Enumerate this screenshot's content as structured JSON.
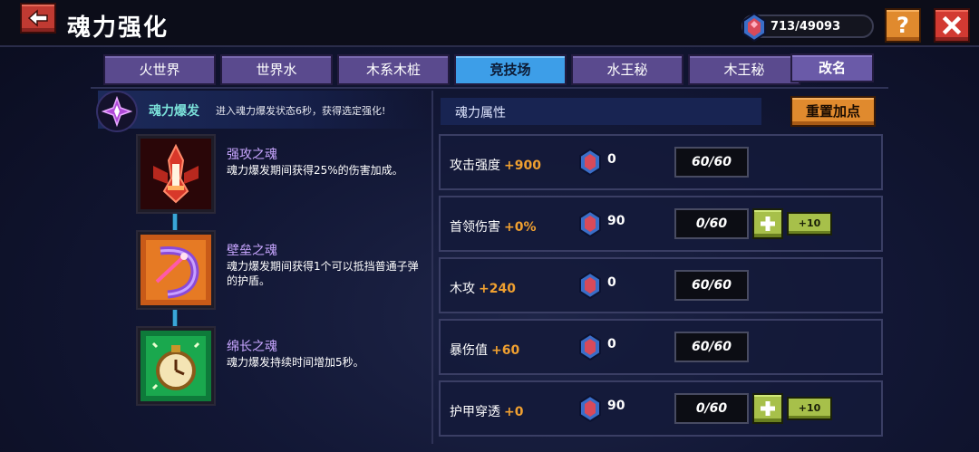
{
  "header": {
    "title": "魂力强化",
    "currency": "713/49093"
  },
  "buttons": {
    "help": "?",
    "rename": "改名",
    "reset": "重置加点"
  },
  "tabs": [
    {
      "label": "火世界",
      "active": false
    },
    {
      "label": "世界水",
      "active": false
    },
    {
      "label": "木系木桩",
      "active": false
    },
    {
      "label": "竞技场",
      "active": true
    },
    {
      "label": "水王秘",
      "active": false
    },
    {
      "label": "木王秘",
      "active": false
    }
  ],
  "burst": {
    "name": "魂力爆发",
    "desc": "进入魂力爆发状态6秒，获得选定强化!"
  },
  "souls": [
    {
      "name": "强攻之魂",
      "desc": "魂力爆发期间获得25%的伤害加成。",
      "icon": "red-sword-soul-icon"
    },
    {
      "name": "壁垒之魂",
      "desc": "魂力爆发期间获得1个可以抵挡普通子弹的护盾。",
      "icon": "orange-shield-soul-icon"
    },
    {
      "name": "绵长之魂",
      "desc": "魂力爆发持续时间增加5秒。",
      "icon": "green-clock-soul-icon"
    }
  ],
  "attr_header": "魂力属性",
  "attributes": [
    {
      "label": "攻击强度",
      "bonus": "+900",
      "cost": "0",
      "level": "60/60",
      "can_upgrade": false
    },
    {
      "label": "首领伤害",
      "bonus": "+0%",
      "cost": "90",
      "level": "0/60",
      "can_upgrade": true,
      "plus10": "+10"
    },
    {
      "label": "木攻",
      "bonus": "+240",
      "cost": "0",
      "level": "60/60",
      "can_upgrade": false
    },
    {
      "label": "暴伤值",
      "bonus": "+60",
      "cost": "0",
      "level": "60/60",
      "can_upgrade": false
    },
    {
      "label": "护甲穿透",
      "bonus": "+0",
      "cost": "90",
      "level": "0/60",
      "can_upgrade": true,
      "plus10": "+10"
    }
  ],
  "colors": {
    "accent_orange": "#e08a2e",
    "tab_active": "#3d9ee8",
    "tab": "#5a4a8e",
    "bonus": "#f0a030",
    "upgrade_green": "#a7c04a"
  }
}
